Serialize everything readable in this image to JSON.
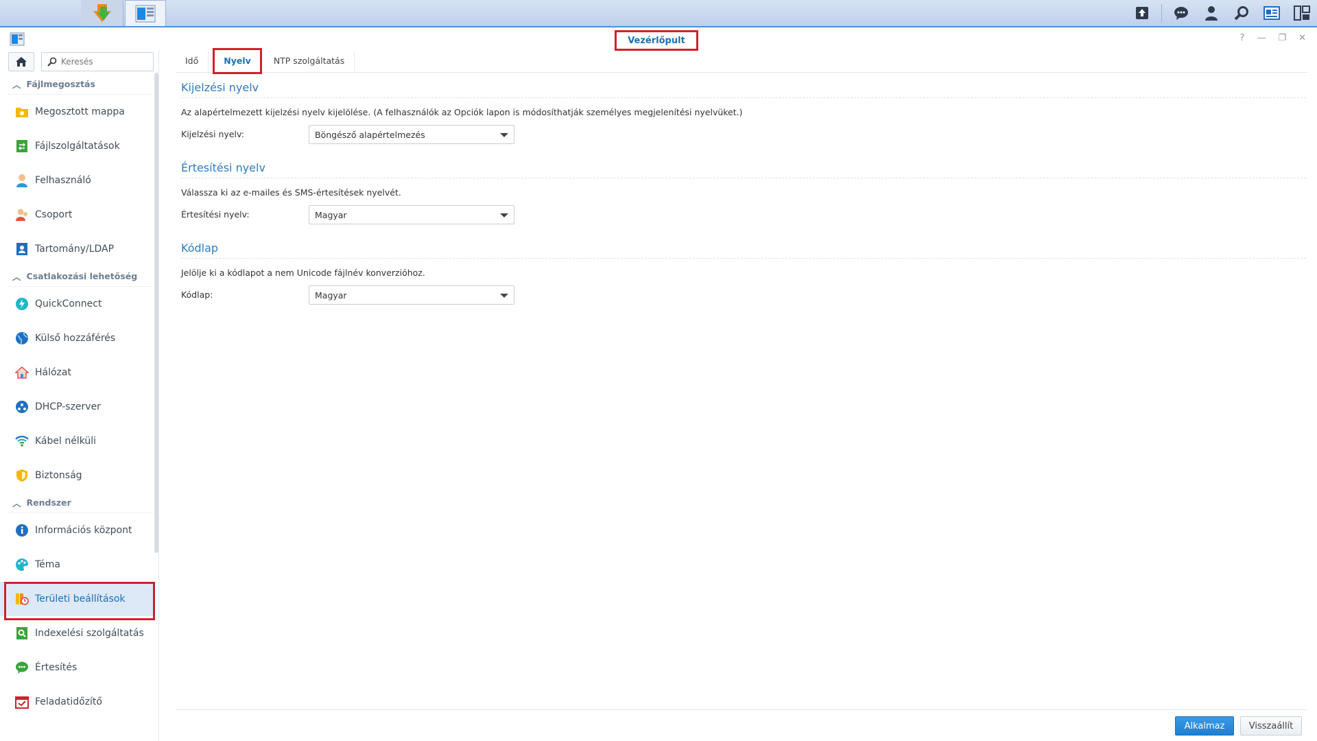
{
  "window": {
    "title": "Vezérlőpult"
  },
  "search": {
    "placeholder": "Keresés"
  },
  "sidebar": {
    "groups": [
      {
        "label": "Fájlmegosztás",
        "items": [
          {
            "label": "Megosztott mappa",
            "icon": "shared-folder-icon"
          },
          {
            "label": "Fájlszolgáltatások",
            "icon": "file-services-icon"
          },
          {
            "label": "Felhasználó",
            "icon": "user-icon"
          },
          {
            "label": "Csoport",
            "icon": "group-icon"
          },
          {
            "label": "Tartomány/LDAP",
            "icon": "domain-ldap-icon"
          }
        ]
      },
      {
        "label": "Csatlakozási lehetőség",
        "items": [
          {
            "label": "QuickConnect",
            "icon": "quickconnect-icon"
          },
          {
            "label": "Külső hozzáférés",
            "icon": "external-access-icon"
          },
          {
            "label": "Hálózat",
            "icon": "network-icon"
          },
          {
            "label": "DHCP-szerver",
            "icon": "dhcp-server-icon"
          },
          {
            "label": "Kábel nélküli",
            "icon": "wireless-icon"
          },
          {
            "label": "Biztonság",
            "icon": "security-shield-icon"
          }
        ]
      },
      {
        "label": "Rendszer",
        "items": [
          {
            "label": "Információs központ",
            "icon": "info-center-icon"
          },
          {
            "label": "Téma",
            "icon": "theme-palette-icon"
          },
          {
            "label": "Területi beállítások",
            "icon": "regional-options-icon",
            "active": true
          },
          {
            "label": "Indexelési szolgáltatás",
            "icon": "indexing-service-icon"
          },
          {
            "label": "Értesítés",
            "icon": "notification-icon"
          },
          {
            "label": "Feladatidőzítő",
            "icon": "task-scheduler-icon"
          }
        ]
      }
    ]
  },
  "tabs": [
    {
      "label": "Idő"
    },
    {
      "label": "Nyelv",
      "active": true
    },
    {
      "label": "NTP szolgáltatás"
    }
  ],
  "sections": {
    "display": {
      "title": "Kijelzési nyelv",
      "desc": "Az alapértelmezett kijelzési nyelv kijelölése. (A felhasználók az Opciók lapon is módosíthatják személyes megjelenítési nyelvüket.)",
      "label": "Kijelzési nyelv:",
      "value": "Böngésző alapértelmezés"
    },
    "notification": {
      "title": "Értesítési nyelv",
      "desc": "Válassza ki az e-mailes és SMS-értesítések nyelvét.",
      "label": "Értesítési nyelv:",
      "value": "Magyar"
    },
    "codepage": {
      "title": "Kódlap",
      "desc": "Jelölje ki a kódlapot a nem Unicode fájlnév konverzióhoz.",
      "label": "Kódlap:",
      "value": "Magyar"
    }
  },
  "footer": {
    "apply": "Alkalmaz",
    "reset": "Visszaállít"
  },
  "colors": {
    "accent": "#1a6fb5",
    "highlight": "#d0202c",
    "active_bg": "#dde9f7"
  }
}
